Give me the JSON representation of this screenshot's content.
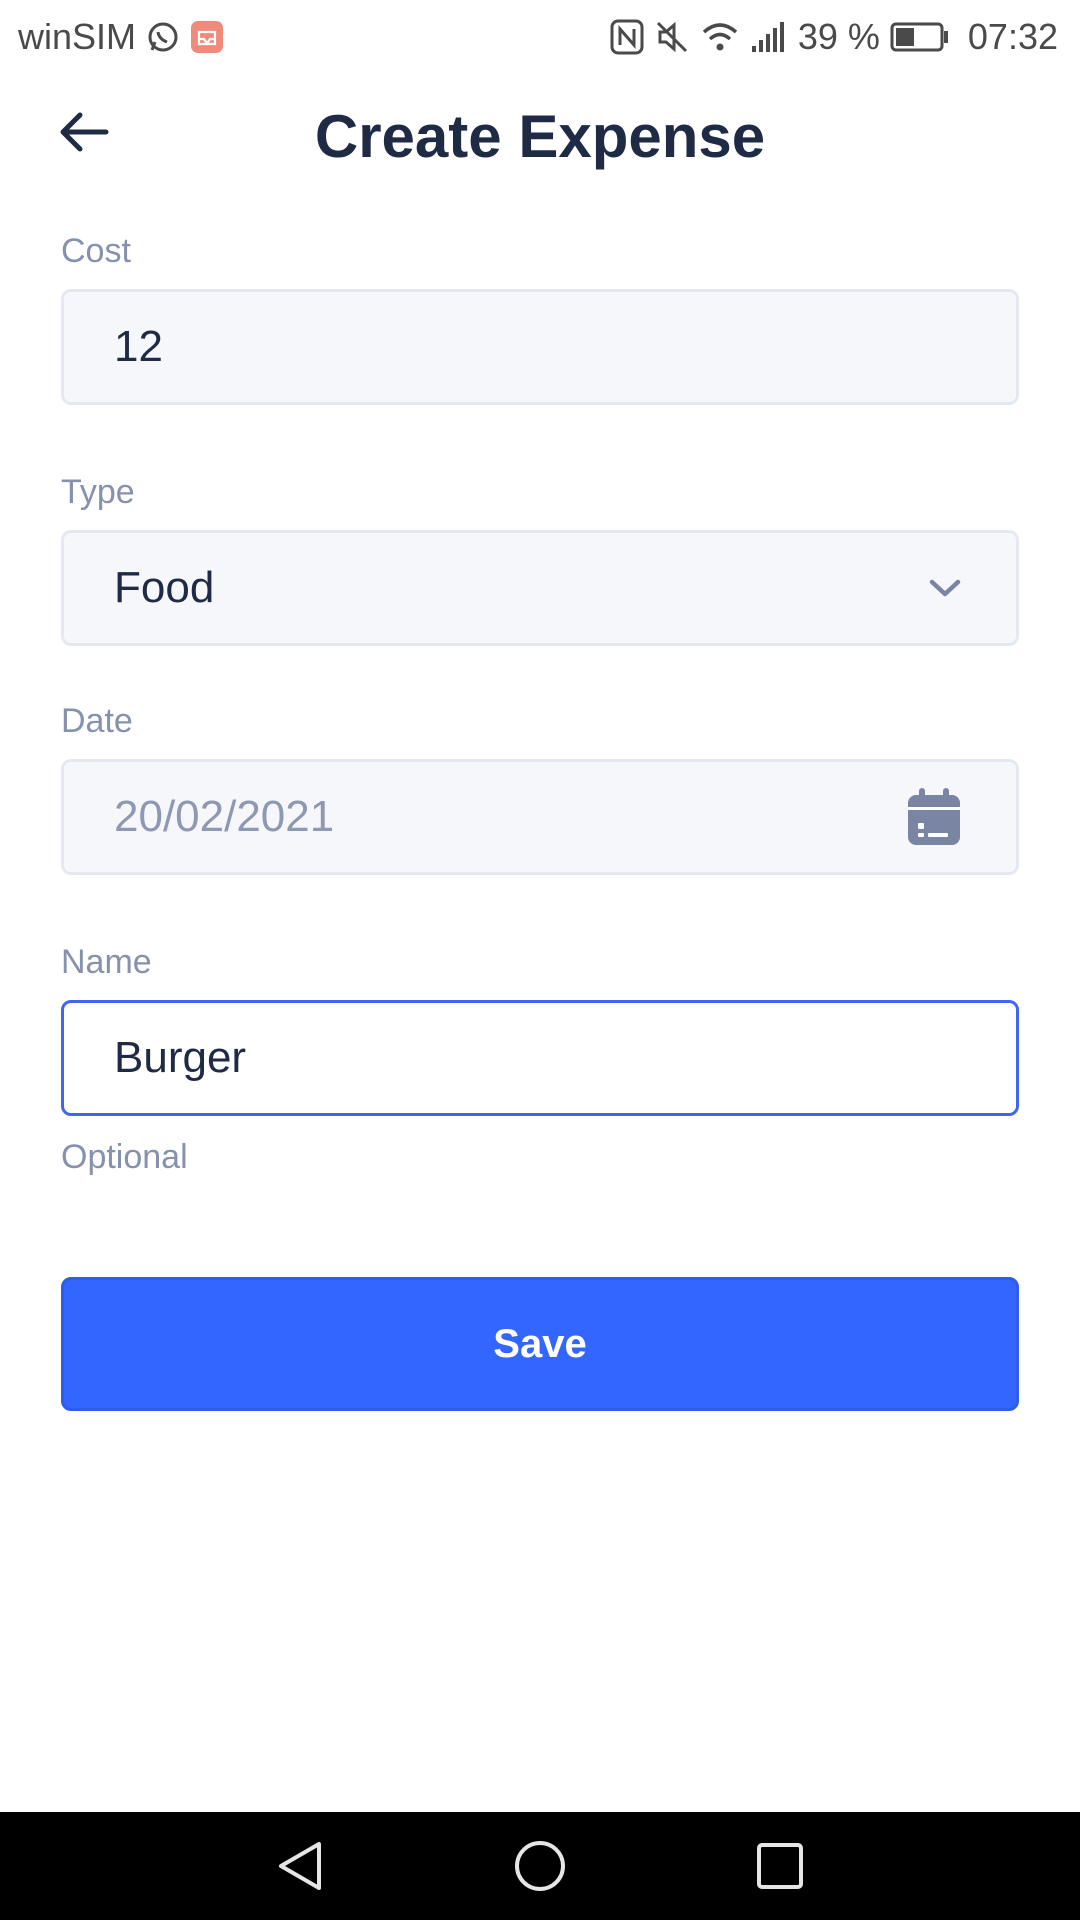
{
  "status_bar": {
    "carrier": "winSIM",
    "battery": "39 %",
    "time": "07:32"
  },
  "header": {
    "title": "Create Expense",
    "back_icon": "arrow-left-icon"
  },
  "form": {
    "cost": {
      "label": "Cost",
      "value": "12"
    },
    "type": {
      "label": "Type",
      "value": "Food",
      "icon": "chevron-down-icon"
    },
    "date": {
      "label": "Date",
      "value": "20/02/2021",
      "icon": "calendar-icon"
    },
    "name": {
      "label": "Name",
      "value": "Burger",
      "helper": "Optional"
    }
  },
  "actions": {
    "save_label": "Save"
  },
  "colors": {
    "accent": "#3366ff",
    "title": "#1f2a44",
    "label": "#8591ad",
    "field_bg": "#f6f7fb",
    "focus_border": "#3f66f0"
  }
}
